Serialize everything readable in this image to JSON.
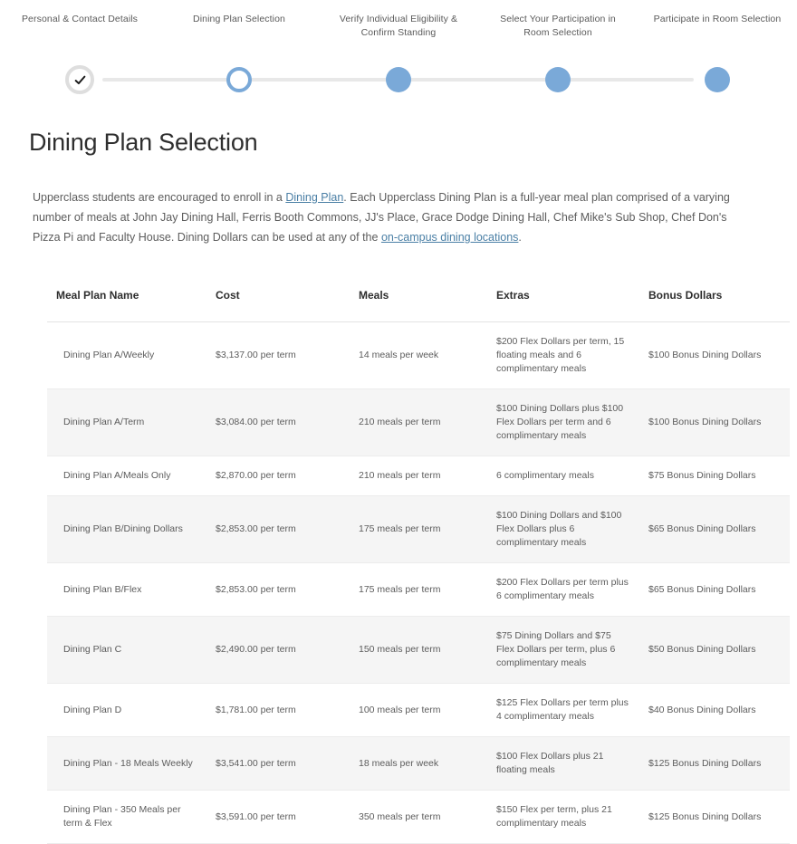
{
  "stepper": {
    "steps": [
      {
        "label": "Personal & Contact Details",
        "state": "done"
      },
      {
        "label": "Dining Plan Selection",
        "state": "current"
      },
      {
        "label": "Verify Individual Eligibility & Confirm Standing",
        "state": "upcoming"
      },
      {
        "label": "Select Your Participation in Room Selection",
        "state": "upcoming"
      },
      {
        "label": "Participate in Room Selection",
        "state": "upcoming"
      }
    ],
    "colors": {
      "done_ring": "#dedede",
      "current_ring": "#7aa9d8",
      "upcoming_fill": "#7aa9d8",
      "track": "#e8e8e8",
      "check_glyph": "#1a1a1a"
    }
  },
  "page": {
    "title": "Dining Plan Selection",
    "intro": {
      "part1": "Upperclass students are encouraged to enroll in a ",
      "link1": "Dining Plan",
      "part2": ". Each Upperclass Dining Plan is a full-year meal plan comprised of a varying number of meals at John Jay Dining Hall, Ferris Booth Commons, JJ's Place, Grace Dodge Dining Hall, Chef Mike's Sub Shop, Chef Don's Pizza Pi and Faculty House. Dining Dollars can be used at any of the ",
      "link2": "on-campus dining locations",
      "part3": "."
    },
    "link_color": "#4a7fa5"
  },
  "table": {
    "headers": [
      "Meal Plan Name",
      "Cost",
      "Meals",
      "Extras",
      "Bonus Dollars"
    ],
    "rows": [
      {
        "name": "Dining Plan A/Weekly",
        "cost": "$3,137.00 per term",
        "meals": "14 meals per week",
        "extras": "$200 Flex Dollars per term, 15 floating meals and 6 complimentary meals",
        "bonus": "$100 Bonus Dining Dollars"
      },
      {
        "name": "Dining Plan A/Term",
        "cost": "$3,084.00 per term",
        "meals": "210 meals per term",
        "extras": "$100 Dining Dollars plus $100 Flex Dollars per term and 6 complimentary meals",
        "bonus": "$100 Bonus Dining Dollars"
      },
      {
        "name": "Dining Plan A/Meals Only",
        "cost": "$2,870.00 per term",
        "meals": "210 meals per term",
        "extras": "6 complimentary meals",
        "bonus": "$75 Bonus Dining Dollars"
      },
      {
        "name": "Dining Plan B/Dining Dollars",
        "cost": "$2,853.00 per term",
        "meals": "175 meals per term",
        "extras": "$100 Dining Dollars and $100 Flex Dollars plus 6 complimentary meals",
        "bonus": "$65 Bonus Dining Dollars"
      },
      {
        "name": "Dining Plan B/Flex",
        "cost": "$2,853.00 per term",
        "meals": "175 meals per term",
        "extras": "$200 Flex Dollars per term plus 6 complimentary meals",
        "bonus": "$65 Bonus Dining Dollars"
      },
      {
        "name": "Dining Plan C",
        "cost": "$2,490.00 per term",
        "meals": "150 meals per term",
        "extras": "$75 Dining Dollars and $75 Flex Dollars per term, plus 6 complimentary meals",
        "bonus": "$50 Bonus Dining Dollars"
      },
      {
        "name": "Dining Plan D",
        "cost": "$1,781.00 per term",
        "meals": "100 meals per term",
        "extras": "$125 Flex Dollars per term plus 4 complimentary meals",
        "bonus": "$40 Bonus Dining Dollars"
      },
      {
        "name": "Dining Plan - 18 Meals Weekly",
        "cost": "$3,541.00 per term",
        "meals": "18 meals per week",
        "extras": "$100 Flex Dollars plus 21 floating meals",
        "bonus": "$125 Bonus Dining Dollars"
      },
      {
        "name": "Dining Plan - 350 Meals per term & Flex",
        "cost": "$3,591.00 per term",
        "meals": "350 meals per term",
        "extras": "$150 Flex per term, plus 21 complimentary meals",
        "bonus": "$125 Bonus Dining Dollars"
      }
    ]
  }
}
